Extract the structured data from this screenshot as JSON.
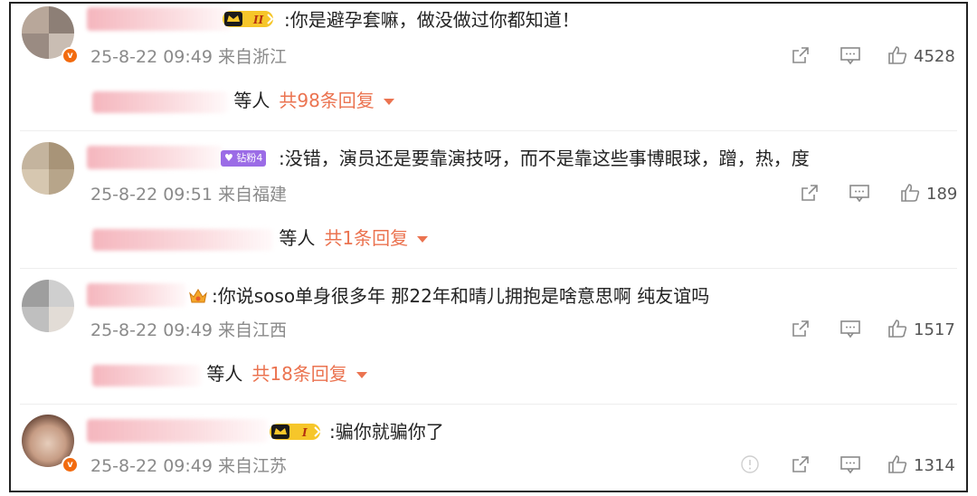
{
  "comments": [
    {
      "text": ":你是避孕套嘛，做没做过你都知道！",
      "time": "25-8-22 09:49",
      "location": "来自浙江",
      "likes": "4528",
      "badge_level": "II",
      "replies": {
        "who": "等人",
        "count": "共98条回复"
      }
    },
    {
      "text": ":没错，演员还是要靠演技呀，而不是靠这些事博眼球，蹭，热，度",
      "time": "25-8-22 09:51",
      "location": "来自福建",
      "likes": "189",
      "fan_badge": "钻粉4",
      "replies": {
        "who": "等人",
        "count": "共1条回复"
      }
    },
    {
      "text": ":你说soso单身很多年 那22年和晴儿拥抱是啥意思啊 纯友谊吗",
      "time": "25-8-22 09:49",
      "location": "来自江西",
      "likes": "1517",
      "replies": {
        "who": "等人",
        "count": "共18条回复"
      }
    },
    {
      "text": ":骗你就骗你了",
      "time": "25-8-22 09:49",
      "location": "来自江苏",
      "likes": "1314",
      "badge_level": "I"
    }
  ],
  "colors": {
    "accent": "#eb7350",
    "meta": "#8a8a8a",
    "vip": "#f26b0f",
    "fan": "#9b6ce6"
  },
  "icons": [
    "forward-icon",
    "comment-icon",
    "like-icon",
    "report-icon",
    "verified-icon",
    "crown-icon"
  ]
}
